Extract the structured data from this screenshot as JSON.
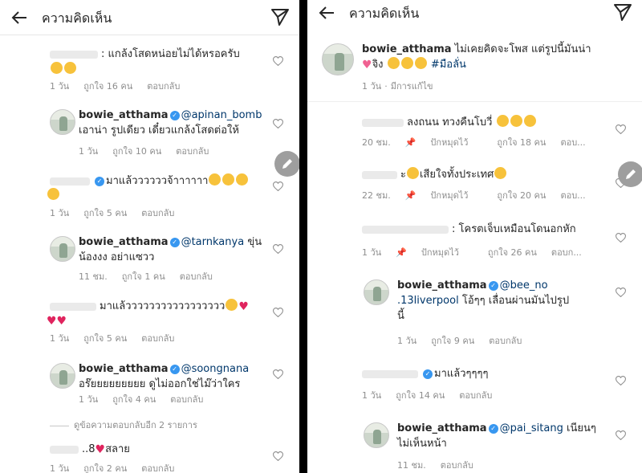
{
  "left": {
    "header": {
      "title": "ความคิดเห็น"
    },
    "view_more_replies": "ดูข้อความตอบกลับอีก 2 รายการ",
    "comments": [
      {
        "user": "",
        "text": ": แกล้งโสดหน่อยไม่ได้หรอครับ",
        "time": "1 วัน",
        "likes": "ถูกใจ 16 คน",
        "reply": "ตอบกลับ"
      },
      {
        "user": "bowie_atthama",
        "mention": "@apinan_bomb",
        "text": "เอาน่า รูปเดียว เดี๋ยวแกล้งโสดต่อให้",
        "time": "1 วัน",
        "likes": "ถูกใจ 10 คน",
        "reply": "ตอบกลับ"
      },
      {
        "user": "",
        "text": "มาแล้ววววววจ้าาาาาา",
        "time": "1 วัน",
        "likes": "ถูกใจ 5 คน",
        "reply": "ตอบกลับ"
      },
      {
        "user": "bowie_atthama",
        "mention": "@tarnkanya",
        "text_inline": "ขุ่น",
        "text": "น้องงง อย่าแซวว",
        "time": "11 ชม.",
        "likes": "ถูกใจ 1 คน",
        "reply": "ตอบกลับ"
      },
      {
        "user": "",
        "text": "มาแล้ววววววววววววววววว",
        "time": "1 วัน",
        "likes": "ถูกใจ 5 คน",
        "reply": "ตอบกลับ"
      },
      {
        "user": "bowie_atthama",
        "mention": "@soongnana",
        "text": "อร๊ยยยยยยยยย ดูไม่ออกใช่ไม๊ว่าใคร",
        "time": "1 วัน",
        "likes": "ถูกใจ 4 คน",
        "reply": "ตอบกลับ"
      },
      {
        "user": "",
        "text_prefix": "..8",
        "text": "สลาย",
        "time": "1 วัน",
        "likes": "ถูกใจ 2 คน",
        "reply": "ตอบกลับ"
      }
    ]
  },
  "right": {
    "header": {
      "title": "ความคิดเห็น"
    },
    "caption": {
      "user": "bowie_atthama",
      "text": "ไม่เคยคิดจะโพส แต่รูปนี้มันน่า",
      "text2": "จิง",
      "hashtag": "#มือลั่น",
      "time": "1 วัน",
      "edited": "มีการแก้ไข"
    },
    "comments": [
      {
        "user": "",
        "text": "ลงถนน ทวงคืนโบวี่",
        "time": "20 ชม.",
        "pin": "ปักหมุดไว้",
        "likes": "ถูกใจ 18 คน",
        "reply": "ตอบ..."
      },
      {
        "user": "",
        "text_prefix": "ะ",
        "text": "เสียใจทั้งประเทศ",
        "time": "22 ชม.",
        "pin": "ปักหมุดไว้",
        "likes": "ถูกใจ 20 คน",
        "reply": "ตอบ..."
      },
      {
        "user": "",
        "text": ": โครตเจ็บเหมือนโดนอกหัก",
        "time": "1 วัน",
        "pin": "ปักหมุดไว้",
        "likes": "ถูกใจ 26 คน",
        "reply": "ตอบก..."
      },
      {
        "user": "bowie_atthama",
        "mention": "@bee_no",
        "mention2": ".13liverpool",
        "text_inline": "โอ้ๆๆ เลื่อนผ่านมันไปรูป",
        "text": "นี้",
        "time": "1 วัน",
        "likes": "ถูกใจ 9 คน",
        "reply": "ตอบกลับ"
      },
      {
        "user": "",
        "text": "มาแล้วๆๆๆๆ",
        "time": "1 วัน",
        "likes": "ถูกใจ 14 คน",
        "reply": "ตอบกลับ"
      },
      {
        "user": "bowie_atthama",
        "mention": "@pai_sitang",
        "text_inline": "เนียนๆ",
        "text": "ไม่เห็นหน้า",
        "time": "11 ชม.",
        "reply": "ตอบกลับ"
      }
    ]
  }
}
